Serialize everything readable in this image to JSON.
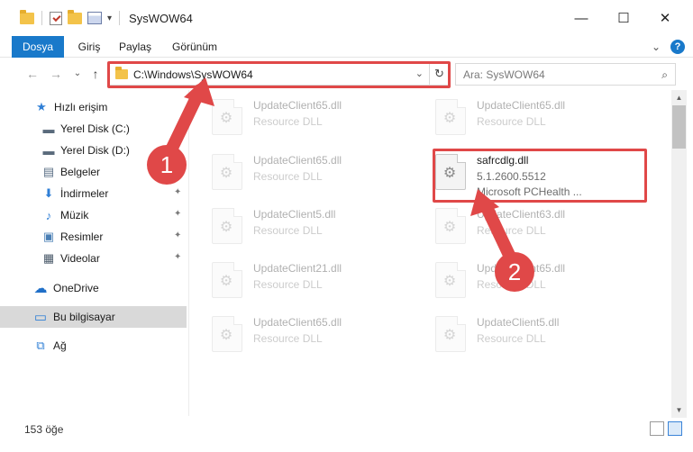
{
  "window": {
    "title": "SysWOW64",
    "minimize": "—",
    "maximize": "☐",
    "close": "✕"
  },
  "ribbon": {
    "tabs": [
      "Dosya",
      "Giriş",
      "Paylaş",
      "Görünüm"
    ],
    "expand": "⌄",
    "help": "?"
  },
  "nav": {
    "back": "←",
    "forward": "→",
    "recent": "⌄",
    "up": "↑",
    "address": "C:\\Windows\\SysWOW64",
    "address_dropdown": "⌄",
    "refresh": "↻",
    "search_placeholder": "Ara: SysWOW64",
    "search_icon": "⌕"
  },
  "sidebar": {
    "items": [
      {
        "label": "Hızlı erişim",
        "icon": "star-icon",
        "glyph": "★",
        "color": "#2f7fd6",
        "pinned": false
      },
      {
        "label": "Yerel Disk (C:)",
        "icon": "drive-icon",
        "glyph": "▬",
        "color": "#5a6b7c",
        "pinned": true
      },
      {
        "label": "Yerel Disk (D:)",
        "icon": "drive-icon",
        "glyph": "▬",
        "color": "#5a6b7c",
        "pinned": true
      },
      {
        "label": "Belgeler",
        "icon": "document-icon",
        "glyph": "▤",
        "color": "#5b6f86",
        "pinned": true
      },
      {
        "label": "İndirmeler",
        "icon": "download-icon",
        "glyph": "⬇",
        "color": "#2f7fd6",
        "pinned": true
      },
      {
        "label": "Müzik",
        "icon": "music-icon",
        "glyph": "♪",
        "color": "#2f7fd6",
        "pinned": true
      },
      {
        "label": "Resimler",
        "icon": "pictures-icon",
        "glyph": "▣",
        "color": "#4a7fb5",
        "pinned": true
      },
      {
        "label": "Videolar",
        "icon": "video-icon",
        "glyph": "▦",
        "color": "#4a5a6a",
        "pinned": true
      },
      {
        "label": "OneDrive",
        "icon": "cloud-icon",
        "glyph": "☁",
        "color": "#1f6fc8",
        "pinned": false
      },
      {
        "label": "Bu bilgisayar",
        "icon": "computer-icon",
        "glyph": "▭",
        "color": "#2f7fd6",
        "pinned": false
      },
      {
        "label": "Ağ",
        "icon": "network-icon",
        "glyph": "⧉",
        "color": "#2f7fd6",
        "pinned": false
      }
    ],
    "pin_glyph": "✦"
  },
  "files": [
    {
      "name": "UpdateClient65.dll",
      "line2": "Resource DLL",
      "line3": "",
      "faded": true
    },
    {
      "name": "UpdateClient65.dll",
      "line2": "Resource DLL",
      "line3": "",
      "faded": true
    },
    {
      "name": "UpdateClient65.dll",
      "line2": "Resource DLL",
      "line3": "",
      "faded": true
    },
    {
      "name": "safrcdlg.dll",
      "line2": "5.1.2600.5512",
      "line3": "Microsoft PCHealth ...",
      "faded": false
    },
    {
      "name": "UpdateClient5.dll",
      "line2": "Resource DLL",
      "line3": "",
      "faded": true
    },
    {
      "name": "UpdateClient63.dll",
      "line2": "Resource DLL",
      "line3": "",
      "faded": true
    },
    {
      "name": "UpdateClient21.dll",
      "line2": "Resource DLL",
      "line3": "",
      "faded": true
    },
    {
      "name": "UpdateClient65.dll",
      "line2": "Resource DLL",
      "line3": "",
      "faded": true
    },
    {
      "name": "UpdateClient65.dll",
      "line2": "Resource DLL",
      "line3": "",
      "faded": true
    },
    {
      "name": "UpdateClient5.dll",
      "line2": "Resource DLL",
      "line3": "",
      "faded": true
    }
  ],
  "annotations": {
    "step1": "1",
    "step2": "2",
    "highlight_color": "#e04848"
  },
  "status": {
    "count": "153 öğe"
  },
  "scroll": {
    "up": "▲",
    "down": "▼"
  }
}
